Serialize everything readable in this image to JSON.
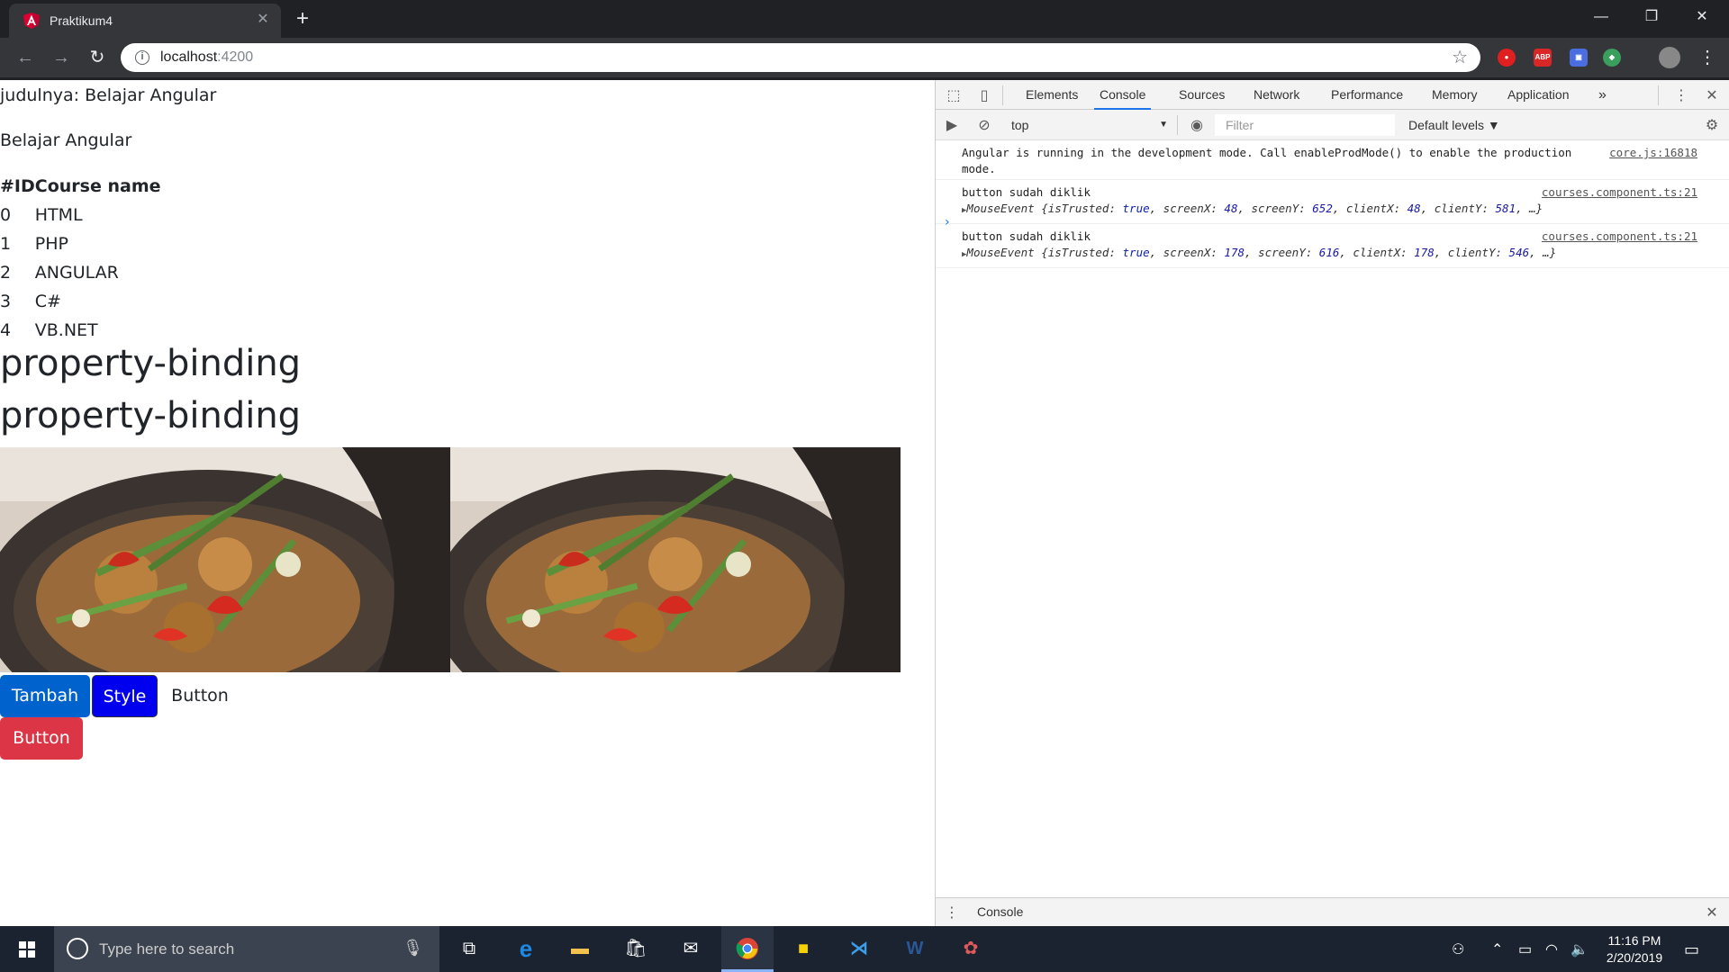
{
  "browser": {
    "tab_title": "Praktikum4",
    "tab_close": "✕",
    "new_tab": "+",
    "url_host": "localhost",
    "url_port": ":4200",
    "window_controls": [
      "—",
      "❐",
      "✕"
    ]
  },
  "page": {
    "judul_line": "judulnya: Belajar Angular",
    "subtitle": "Belajar Angular",
    "table": {
      "headers": [
        "#ID",
        "Course name"
      ],
      "rows": [
        [
          "0",
          "HTML"
        ],
        [
          "1",
          "PHP"
        ],
        [
          "2",
          "ANGULAR"
        ],
        [
          "3",
          "C#"
        ],
        [
          "4",
          "VB.NET"
        ]
      ]
    },
    "heading_1": "property-binding",
    "heading_2": "property-binding",
    "buttons": {
      "tambah": "Tambah",
      "style": "Style",
      "plain": "Button",
      "red": "Button"
    },
    "colors": {
      "primary": "#0062cc",
      "blue": "#0000ee",
      "danger": "#dc3545"
    }
  },
  "devtools": {
    "tabs": [
      "Elements",
      "Console",
      "Sources",
      "Network",
      "Performance",
      "Memory",
      "Application"
    ],
    "active_tab": "Console",
    "more_tabs": "»",
    "context": "top",
    "filter_placeholder": "Filter",
    "levels": "Default levels ▼",
    "logs": [
      {
        "text": "Angular is running in the development mode. Call enableProdMode() to enable the production mode.",
        "source": "core.js:16818"
      },
      {
        "text": "button sudah diklik",
        "source": "courses.component.ts:21",
        "obj": {
          "screenX": "48",
          "screenY": "652",
          "clientX": "48",
          "clientY": "581"
        }
      },
      {
        "text": "button sudah diklik",
        "source": "courses.component.ts:21",
        "obj": {
          "screenX": "178",
          "screenY": "616",
          "clientX": "178",
          "clientY": "546"
        }
      }
    ],
    "obj_prefix": "MouseEvent {isTrusted: ",
    "obj_true": "true",
    "prompt": "›",
    "drawer_label": "Console"
  },
  "taskbar": {
    "search_placeholder": "Type here to search",
    "time": "11:16 PM",
    "date": "2/20/2019"
  }
}
